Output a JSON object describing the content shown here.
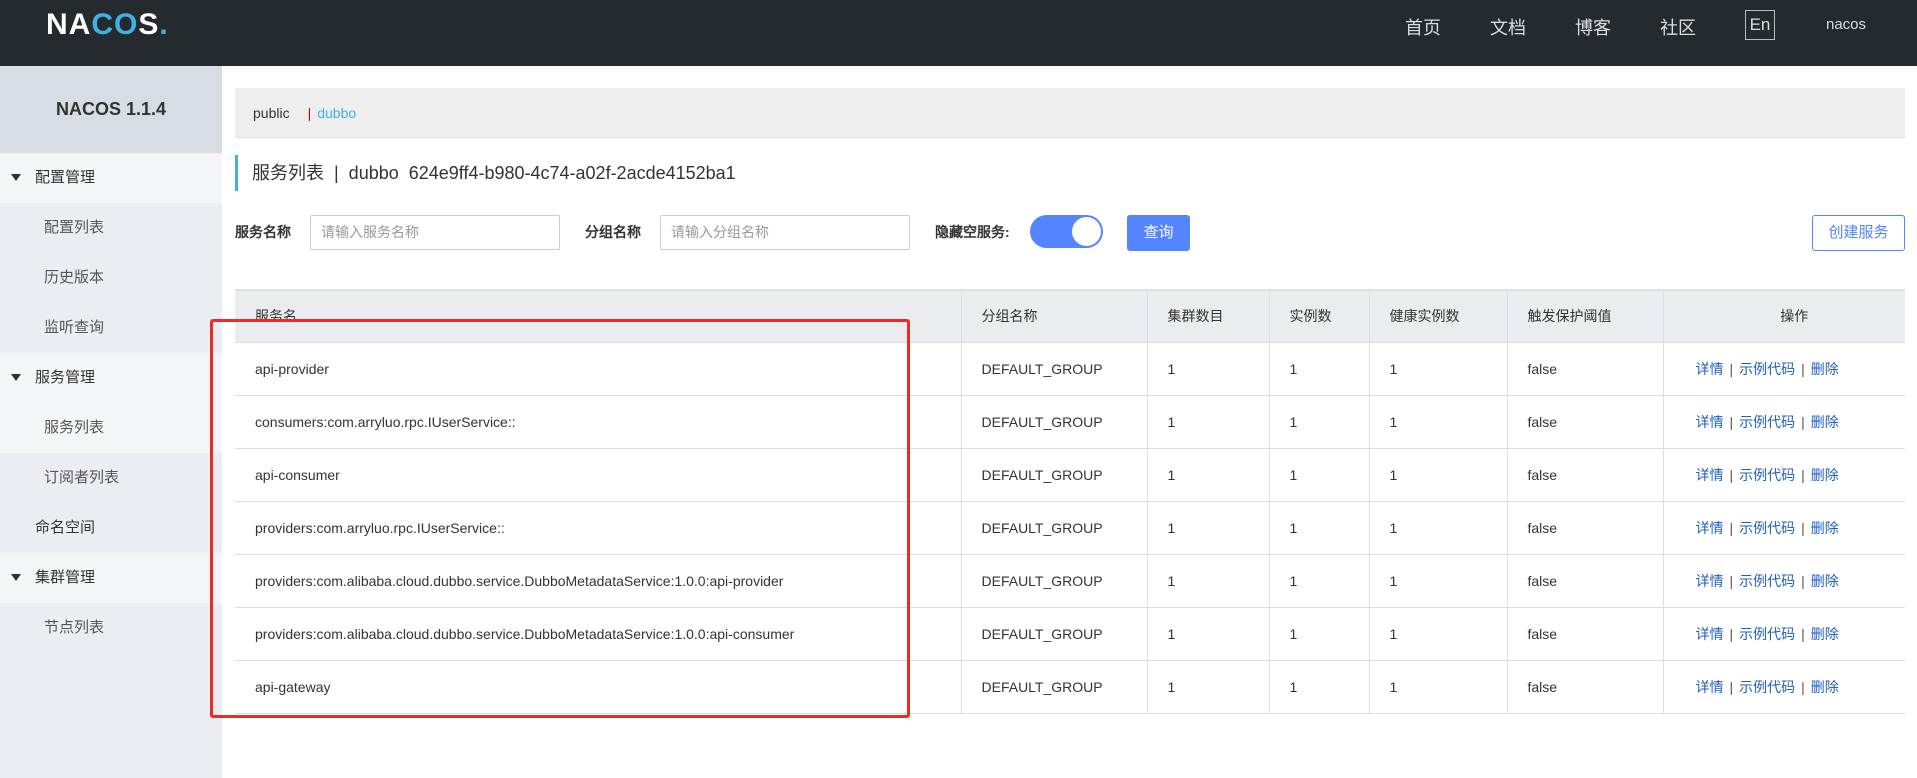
{
  "header": {
    "logo": "NACOS.",
    "nav": [
      "首页",
      "文档",
      "博客",
      "社区"
    ],
    "lang": "En",
    "user": "nacos"
  },
  "sidebar": {
    "version": "NACOS 1.1.4",
    "items": [
      {
        "label": "配置管理",
        "type": "group"
      },
      {
        "label": "配置列表",
        "type": "child"
      },
      {
        "label": "历史版本",
        "type": "child"
      },
      {
        "label": "监听查询",
        "type": "child"
      },
      {
        "label": "服务管理",
        "type": "group"
      },
      {
        "label": "服务列表",
        "type": "child",
        "active": true
      },
      {
        "label": "订阅者列表",
        "type": "child"
      },
      {
        "label": "命名空间",
        "type": "plain"
      },
      {
        "label": "集群管理",
        "type": "group"
      },
      {
        "label": "节点列表",
        "type": "child"
      }
    ]
  },
  "namespaces": {
    "items": [
      "public",
      "dubbo"
    ],
    "active": "dubbo"
  },
  "title": "服务列表  |  dubbo  624e9ff4-b980-4c74-a02f-2acde4152ba1",
  "filters": {
    "service_label": "服务名称",
    "service_placeholder": "请输入服务名称",
    "group_label": "分组名称",
    "group_placeholder": "请输入分组名称",
    "hide_empty_label": "隐藏空服务:",
    "hide_empty_on": true,
    "query": "查询",
    "create": "创建服务"
  },
  "table": {
    "headers": [
      "服务名",
      "分组名称",
      "集群数目",
      "实例数",
      "健康实例数",
      "触发保护阈值",
      "操作"
    ],
    "rows": [
      [
        "api-provider",
        "DEFAULT_GROUP",
        "1",
        "1",
        "1",
        "false"
      ],
      [
        "consumers:com.arryluo.rpc.IUserService::",
        "DEFAULT_GROUP",
        "1",
        "1",
        "1",
        "false"
      ],
      [
        "api-consumer",
        "DEFAULT_GROUP",
        "1",
        "1",
        "1",
        "false"
      ],
      [
        "providers:com.arryluo.rpc.IUserService::",
        "DEFAULT_GROUP",
        "1",
        "1",
        "1",
        "false"
      ],
      [
        "providers:com.alibaba.cloud.dubbo.service.DubboMetadataService:1.0.0:api-provider",
        "DEFAULT_GROUP",
        "1",
        "1",
        "1",
        "false"
      ],
      [
        "providers:com.alibaba.cloud.dubbo.service.DubboMetadataService:1.0.0:api-consumer",
        "DEFAULT_GROUP",
        "1",
        "1",
        "1",
        "false"
      ],
      [
        "api-gateway",
        "DEFAULT_GROUP",
        "1",
        "1",
        "1",
        "false"
      ]
    ],
    "actions": [
      "详情",
      "示例代码",
      "删除"
    ]
  },
  "colors": {
    "accent": "#5584ff",
    "highlight_box": "#ee2a24",
    "topbar": "#252a2f"
  }
}
